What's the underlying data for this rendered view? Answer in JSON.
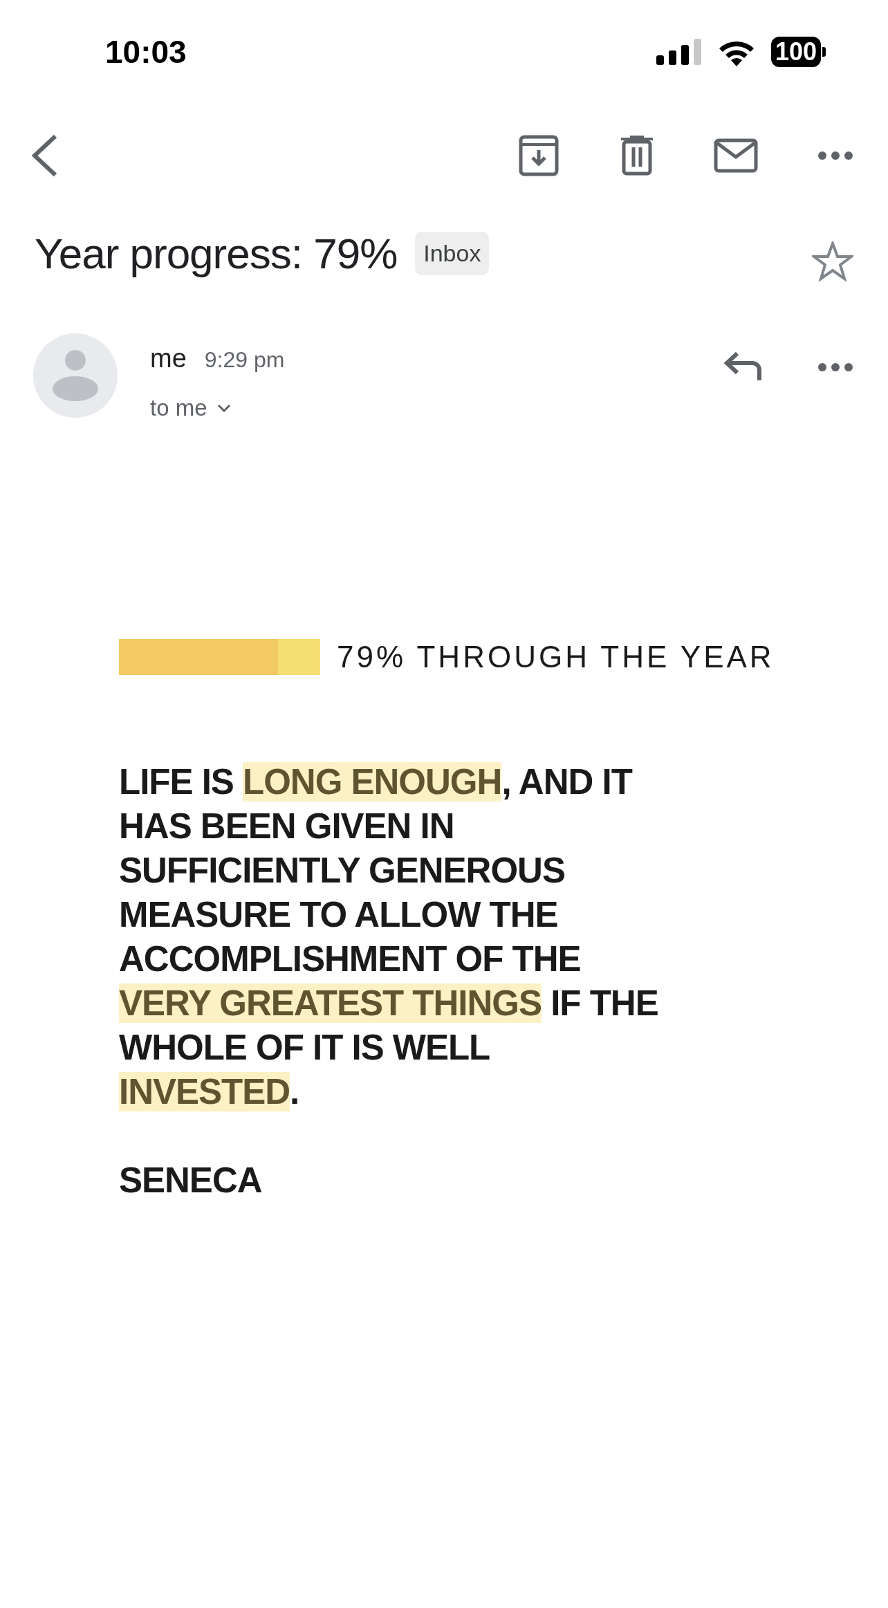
{
  "status_bar": {
    "time": "10:03",
    "battery": "100"
  },
  "subject": {
    "title": "Year progress: 79%",
    "label": "Inbox",
    "starred": false
  },
  "message": {
    "sender": "me",
    "time": "9:29 pm",
    "recipients": "to me"
  },
  "progress": {
    "level": 0.79,
    "caption": "79% THROUGH THE YEAR"
  },
  "quote": {
    "lines": [
      [
        {
          "text": "LIFE IS ",
          "highlighted": false
        },
        {
          "text": "LONG ENOUGH",
          "highlighted": true
        },
        {
          "text": ", AND IT",
          "highlighted": false
        }
      ],
      [
        {
          "text": "HAS BEEN GIVEN IN",
          "highlighted": false
        }
      ],
      [
        {
          "text": "SUFFICIENTLY GENEROUS",
          "highlighted": false
        }
      ],
      [
        {
          "text": "MEASURE TO ALLOW THE",
          "highlighted": false
        }
      ],
      [
        {
          "text": "ACCOMPLISHMENT OF THE",
          "highlighted": false
        }
      ],
      [
        {
          "text": "VERY GREATEST THINGS",
          "highlighted": true
        },
        {
          "text": " IF THE",
          "highlighted": false
        }
      ],
      [
        {
          "text": "WHOLE OF IT IS WELL",
          "highlighted": false
        }
      ],
      [
        {
          "text": "INVESTED",
          "highlighted": true
        },
        {
          "text": ".",
          "highlighted": false
        }
      ]
    ],
    "author": "SENECA"
  }
}
